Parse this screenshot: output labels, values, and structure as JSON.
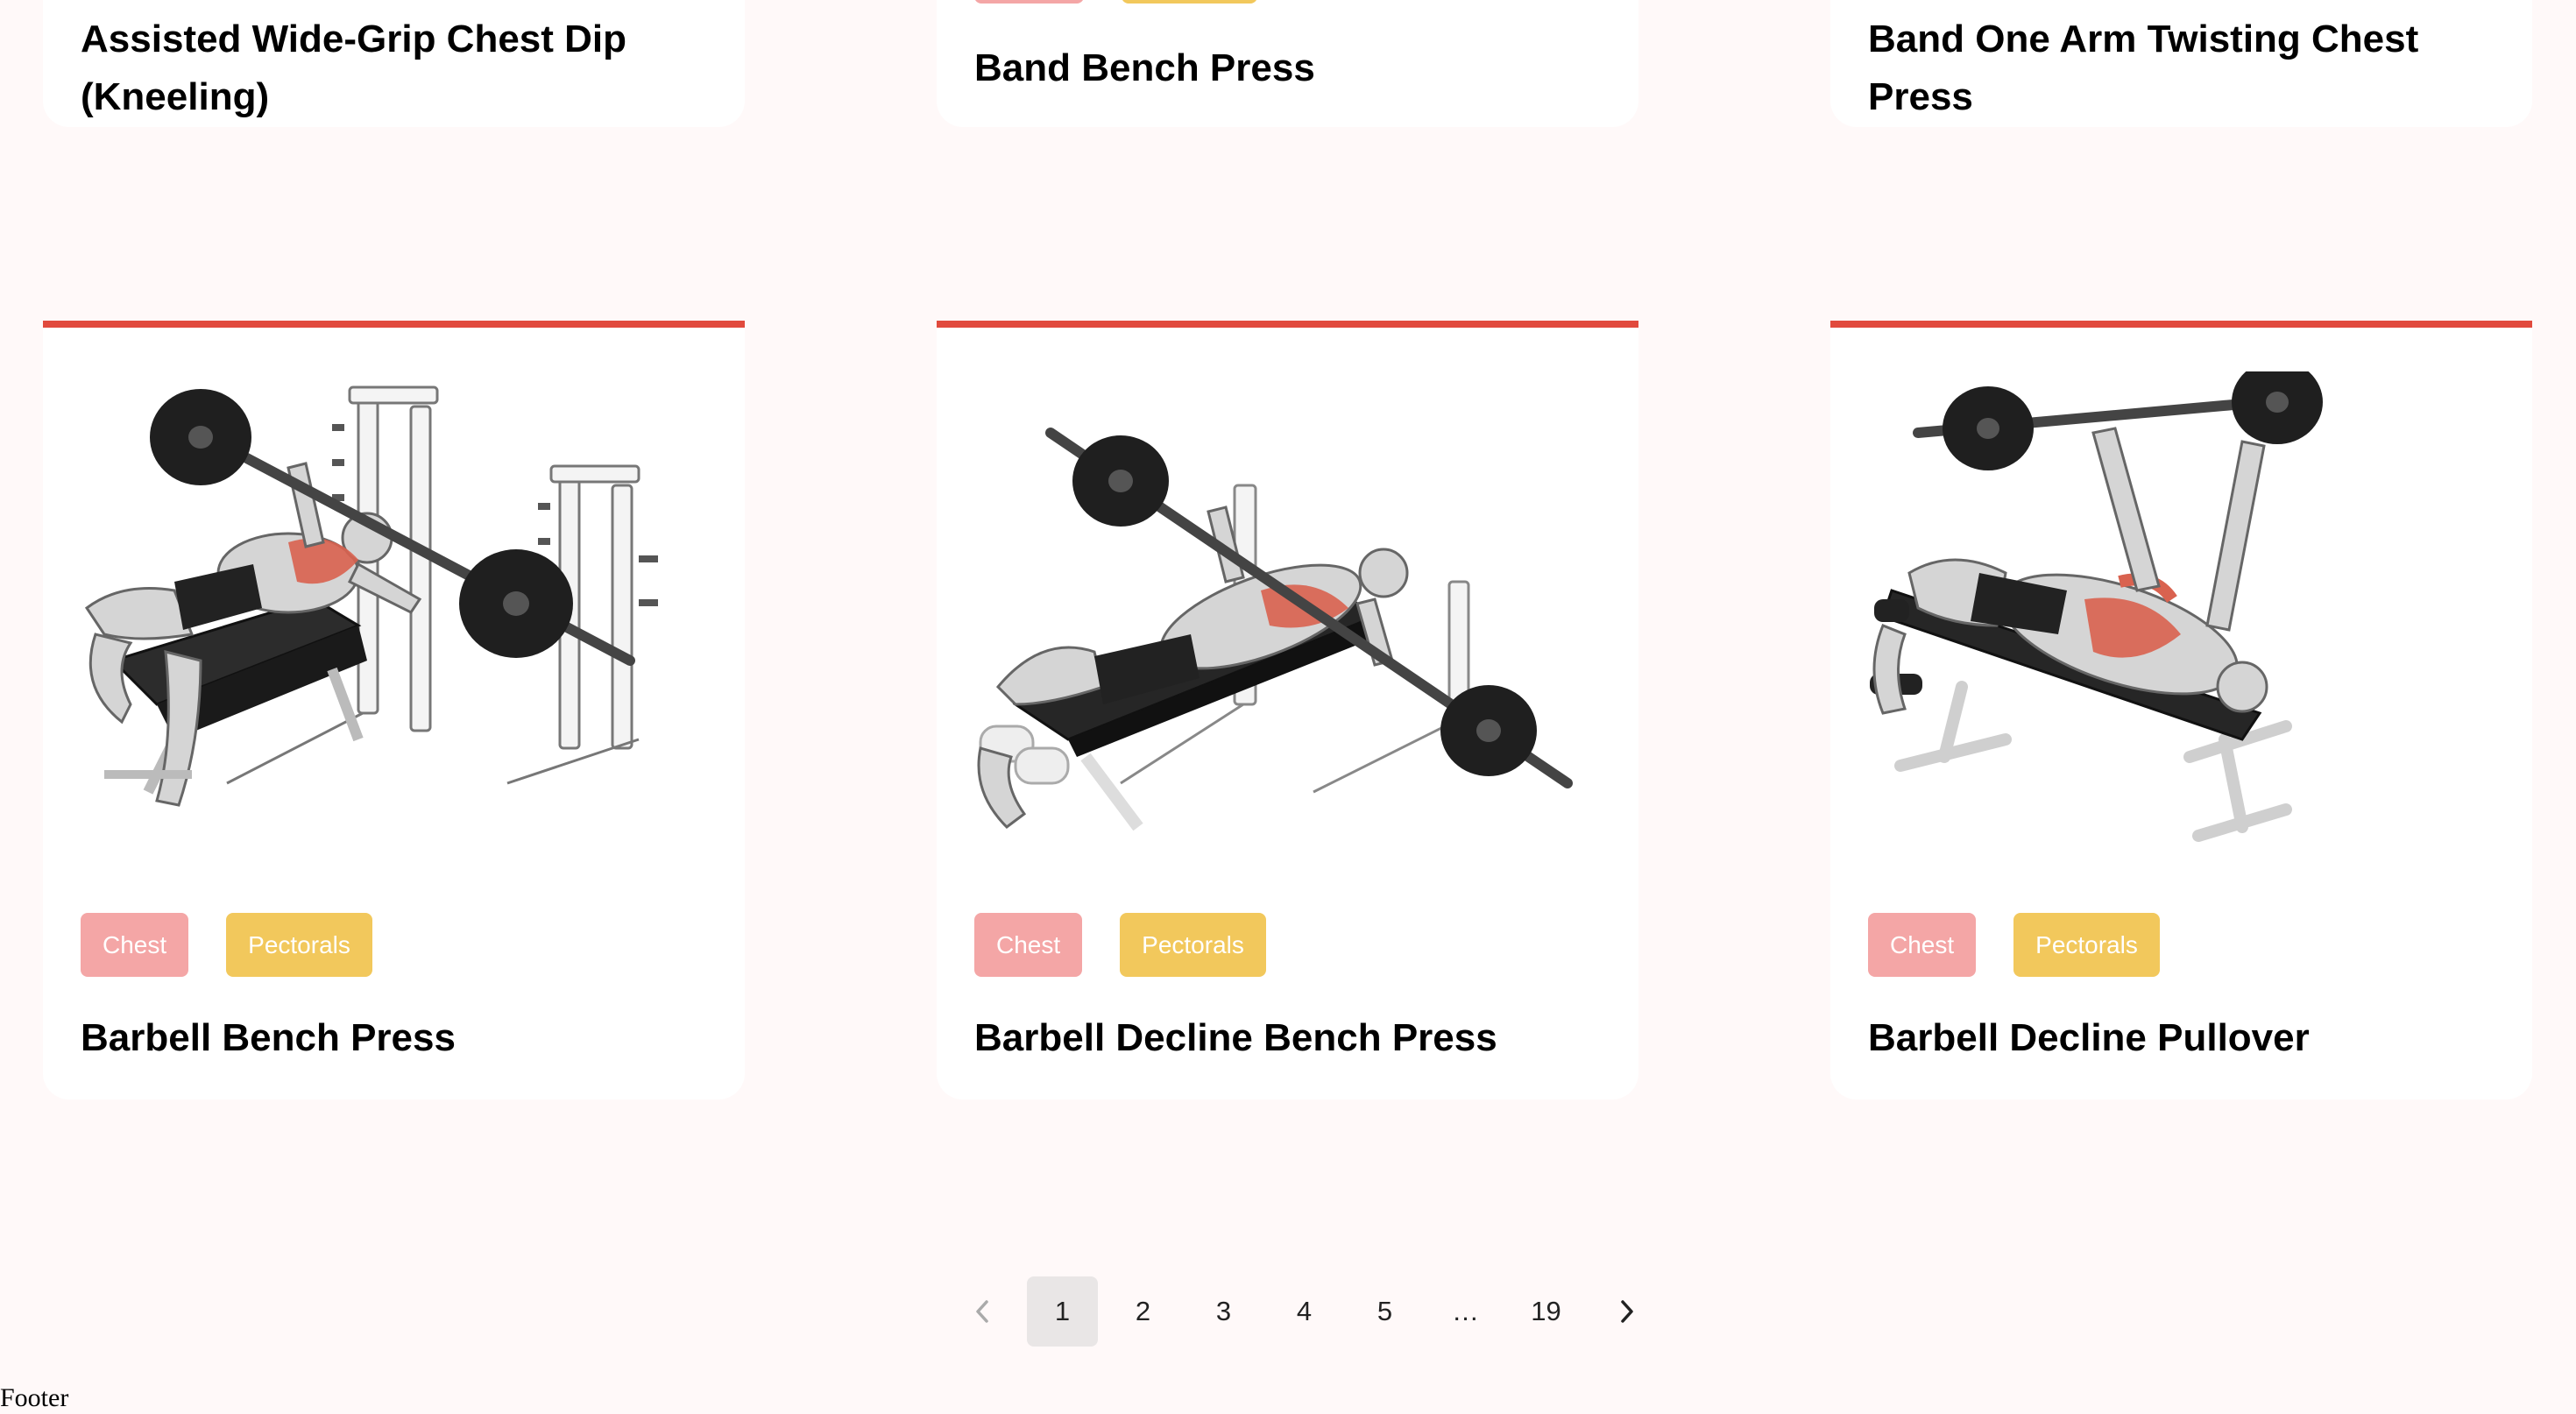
{
  "top_row_cards": [
    {
      "title": "Assisted Wide-Grip Chest Dip (Kneeling)"
    },
    {
      "title": "Band Bench Press"
    },
    {
      "title": "Band One Arm Twisting Chest Press"
    }
  ],
  "cards": [
    {
      "title": "Barbell Bench Press",
      "tags": [
        "Chest",
        "Pectorals"
      ],
      "image_alt": "barbell-bench-press-illustration"
    },
    {
      "title": "Barbell Decline Bench Press",
      "tags": [
        "Chest",
        "Pectorals"
      ],
      "image_alt": "barbell-decline-bench-press-illustration"
    },
    {
      "title": "Barbell Decline Pullover",
      "tags": [
        "Chest",
        "Pectorals"
      ],
      "image_alt": "barbell-decline-pullover-illustration"
    }
  ],
  "pagination": {
    "prev_icon": "chevron-left-icon",
    "next_icon": "chevron-right-icon",
    "pages": [
      "1",
      "2",
      "3",
      "4",
      "5",
      "…",
      "19"
    ],
    "current": "1"
  },
  "footer": {
    "text": "Footer"
  },
  "colors": {
    "page_background": "#fff9f9",
    "card_background": "#ffffff",
    "card_accent": "#e14a3d",
    "tag_primary": "#f4a6a6",
    "tag_secondary": "#f2c85c",
    "active_page": "#e9e6e6",
    "muscle_highlight": "#d9624f"
  }
}
